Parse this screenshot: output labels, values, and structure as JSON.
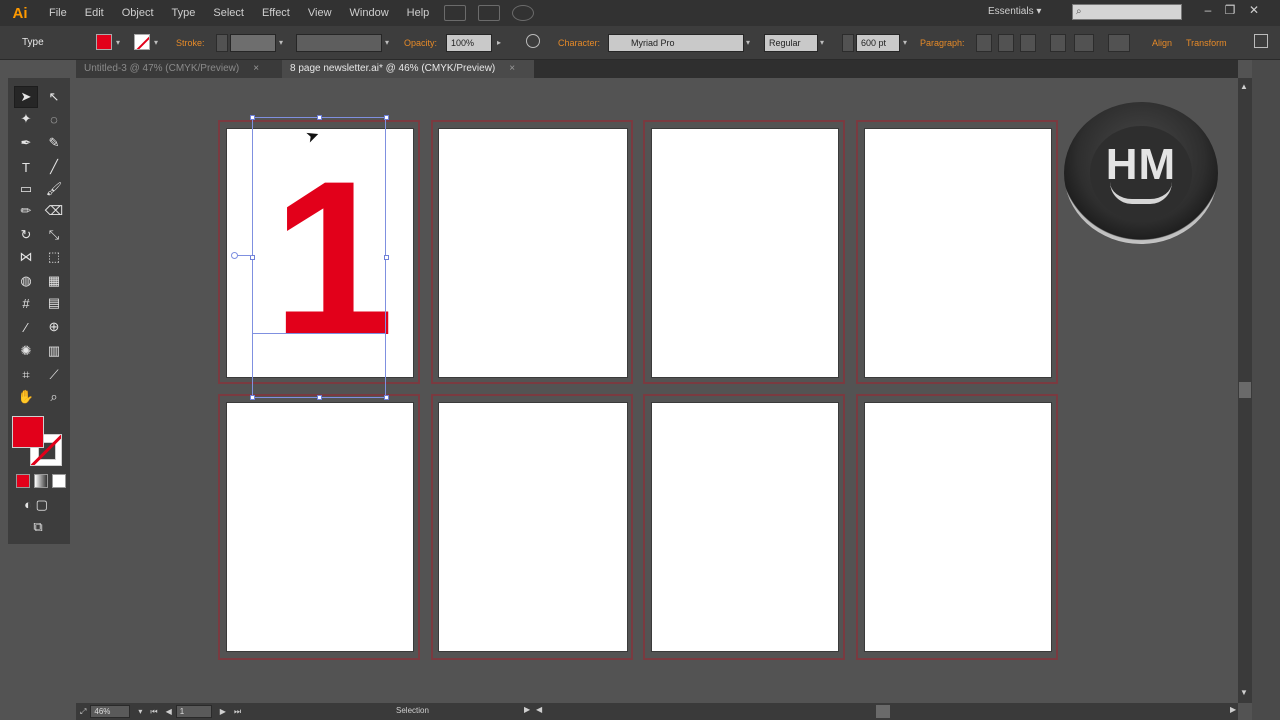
{
  "app": {
    "logo": "Ai"
  },
  "menu": [
    "File",
    "Edit",
    "Object",
    "Type",
    "Select",
    "Effect",
    "View",
    "Window",
    "Help"
  ],
  "workspace": "Essentials",
  "control_bar": {
    "tool_label": "Type",
    "stroke_label": "Stroke:",
    "opacity_label": "Opacity:",
    "opacity_value": "100%",
    "character_label": "Character:",
    "font_family": "Myriad Pro",
    "font_style": "Regular",
    "font_size": "600 pt",
    "paragraph_label": "Paragraph:",
    "align_label": "Align",
    "transform_label": "Transform"
  },
  "tabs": [
    {
      "label": "Untitled-3 @ 47% (CMYK/Preview)",
      "active": false
    },
    {
      "label": "8 page newsletter.ai* @ 46% (CMYK/Preview)",
      "active": true
    }
  ],
  "canvas": {
    "page_number_text": "1"
  },
  "logo": {
    "text": "HM"
  },
  "status": {
    "zoom": "46%",
    "artboard": "1",
    "mode": "Selection"
  },
  "colors": {
    "fill": "#e2001a",
    "stroke": "none",
    "artboard_border": "#7a3a40",
    "selection": "#7f90e0"
  }
}
